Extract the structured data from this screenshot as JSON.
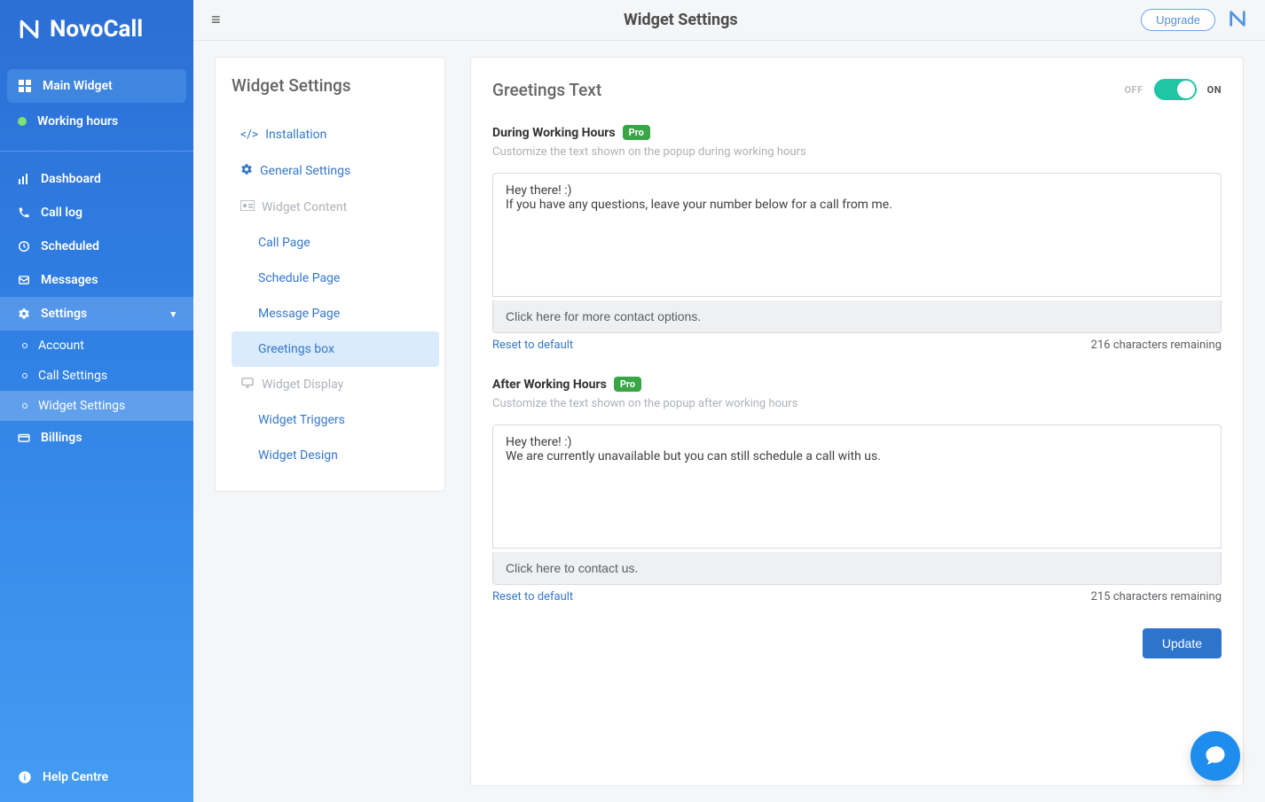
{
  "brand": "NovoCall",
  "topbar": {
    "title": "Widget Settings",
    "upgrade": "Upgrade"
  },
  "sidebar": {
    "main_widget": "Main Widget",
    "working_hours": "Working hours",
    "dashboard": "Dashboard",
    "call_log": "Call log",
    "scheduled": "Scheduled",
    "messages": "Messages",
    "settings": "Settings",
    "account": "Account",
    "call_settings": "Call Settings",
    "widget_settings": "Widget Settings",
    "billings": "Billings",
    "help": "Help Centre"
  },
  "ws_panel": {
    "title": "Widget Settings",
    "installation": "Installation",
    "general": "General Settings",
    "content": "Widget Content",
    "call_page": "Call Page",
    "schedule_page": "Schedule Page",
    "message_page": "Message Page",
    "greetings_box": "Greetings box",
    "display": "Widget Display",
    "triggers": "Widget Triggers",
    "design": "Widget Design"
  },
  "greetings": {
    "title": "Greetings Text",
    "off": "OFF",
    "on": "ON",
    "during": {
      "label": "During Working Hours",
      "badge": "Pro",
      "desc": "Customize the text shown on the popup during working hours",
      "text": "Hey there! :)\nIf you have any questions, leave your number below for a call from me.",
      "contact": "Click here for more contact options.",
      "reset": "Reset to default",
      "remaining": "216 characters remaining"
    },
    "after": {
      "label": "After Working Hours",
      "badge": "Pro",
      "desc": "Customize the text shown on the popup after working hours",
      "text": "Hey there! :)\nWe are currently unavailable but you can still schedule a call with us.",
      "contact": "Click here to contact us.",
      "reset": "Reset to default",
      "remaining": "215 characters remaining"
    },
    "update": "Update"
  }
}
